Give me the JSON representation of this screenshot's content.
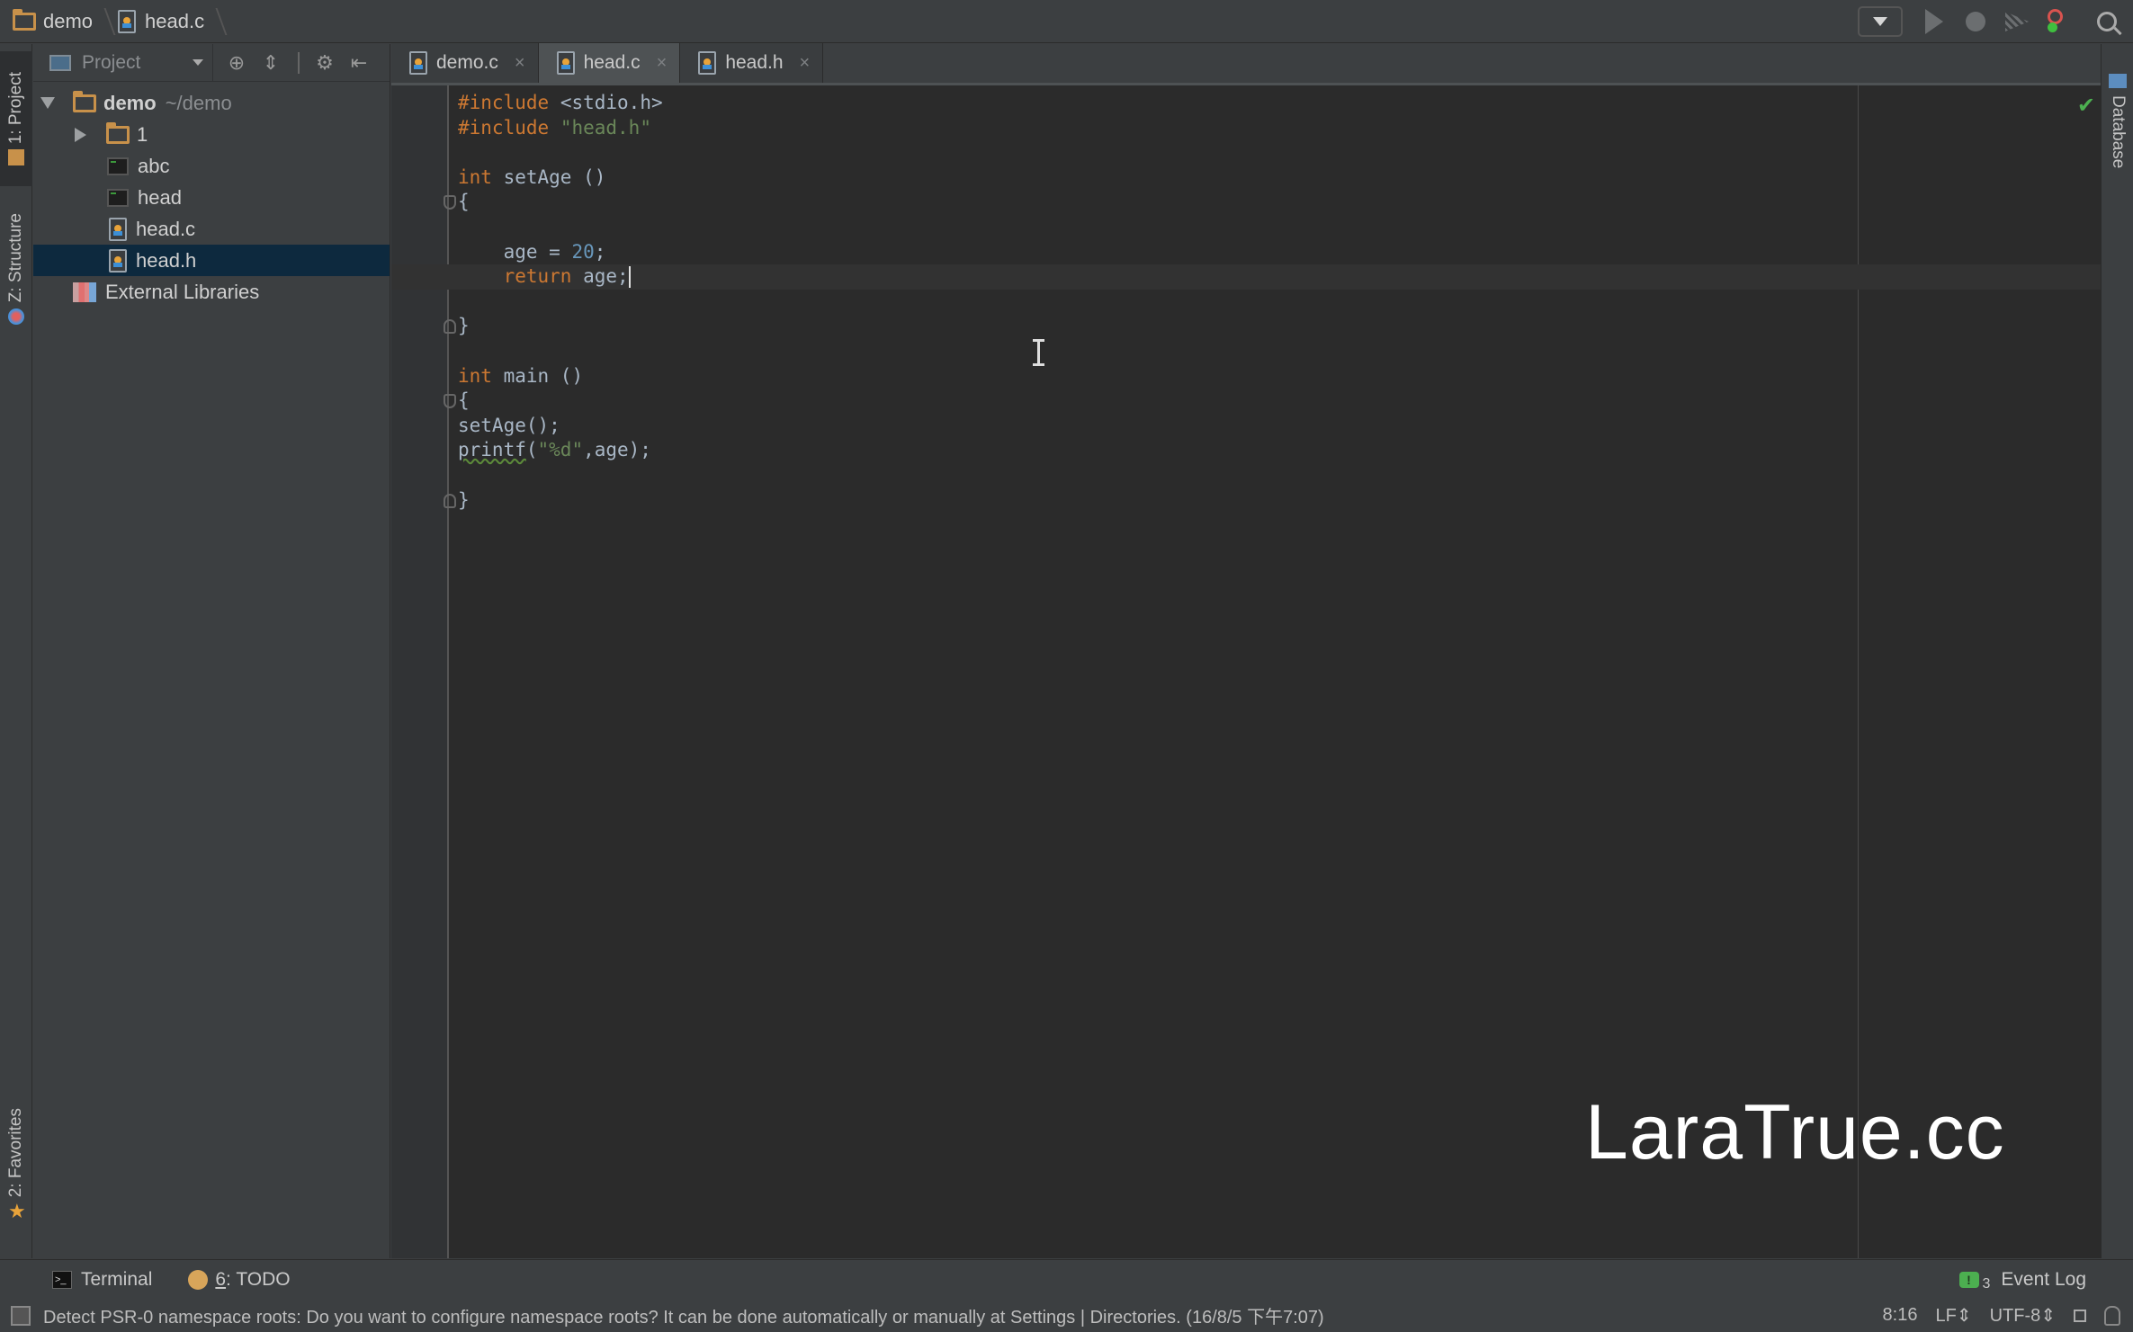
{
  "breadcrumb": [
    {
      "label": "demo",
      "icon": "folder-icon"
    },
    {
      "label": "head.c",
      "icon": "c-file-icon"
    }
  ],
  "toolbar": {
    "run_config_icon": "dropdown-arrow",
    "actions": [
      "run-icon",
      "debug-icon",
      "coverage-icon",
      "attach-debugger-icon",
      "search-icon"
    ]
  },
  "left_stripe": {
    "tabs": [
      {
        "label": "1: Project",
        "active": true
      },
      {
        "label": "Z: Structure",
        "active": false
      },
      {
        "label": "2: Favorites",
        "active": false
      }
    ]
  },
  "right_stripe": {
    "tabs": [
      {
        "label": "Database"
      }
    ]
  },
  "project_panel": {
    "view_label": "Project",
    "tree": [
      {
        "label": "demo",
        "suffix": "~/demo",
        "type": "folder",
        "expanded": true,
        "depth": 0
      },
      {
        "label": "1",
        "type": "folder",
        "expanded": false,
        "depth": 1
      },
      {
        "label": "abc",
        "type": "executable",
        "depth": 1
      },
      {
        "label": "head",
        "type": "executable",
        "depth": 1
      },
      {
        "label": "head.c",
        "type": "c-file",
        "depth": 1
      },
      {
        "label": "head.h",
        "type": "h-file",
        "depth": 1,
        "selected": true
      },
      {
        "label": "External Libraries",
        "type": "library",
        "depth": 0
      }
    ]
  },
  "editor": {
    "tabs": [
      {
        "label": "demo.c",
        "active": false
      },
      {
        "label": "head.c",
        "active": true
      },
      {
        "label": "head.h",
        "active": false
      }
    ],
    "close_glyph": "×",
    "code": {
      "include1_kw": "#include",
      "include1_arg": "<stdio.h>",
      "include2_kw": "#include",
      "include2_arg": "\"head.h\"",
      "fn1_type": "int",
      "fn1_sig": "setAge ()",
      "open_brace": "{",
      "close_brace": "}",
      "assign_lhs": "age = ",
      "assign_num": "20",
      "semicolon": ";",
      "return_kw": "return",
      "return_val": "age;",
      "fn2_type": "int",
      "fn2_sig": "main ()",
      "call_setage": "setAge();",
      "printf_fn": "printf",
      "printf_open": "(",
      "printf_fmt": "\"%d\"",
      "printf_rest": ",age);"
    },
    "inspection_ok": "✔"
  },
  "watermark": "LaraTrue.cc",
  "bottom_tools": {
    "terminal": "Terminal",
    "todo_num": "6",
    "todo_label": ": TODO",
    "event_log": "Event Log",
    "event_count": "3"
  },
  "status_bar": {
    "message": "Detect PSR-0 namespace roots: Do you want to configure namespace roots? It can be done automatically or manually at Settings | Directories. (16/8/5 下午7:07)",
    "position": "8:16",
    "line_sep": "LF⇕",
    "encoding": "UTF-8⇕"
  }
}
